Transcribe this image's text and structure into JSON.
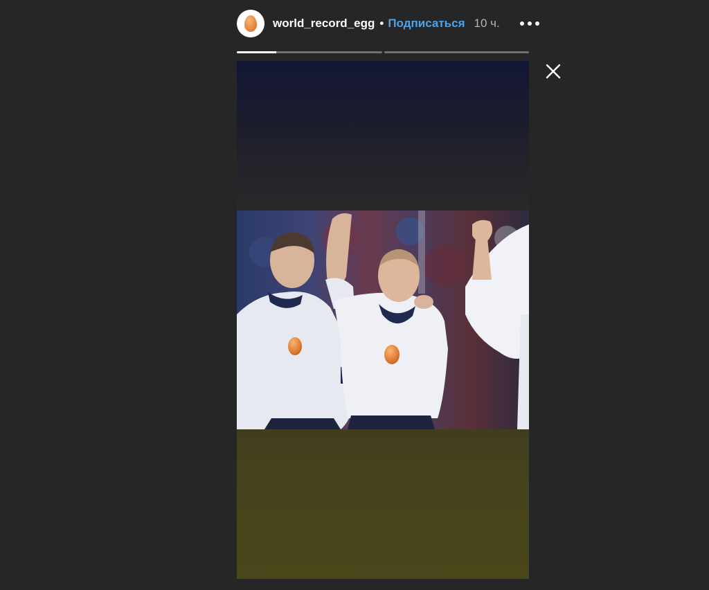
{
  "story": {
    "username": "world_record_egg",
    "separator": "•",
    "follow_label": "Подписаться",
    "time_ago": "10 ч.",
    "segments": [
      {
        "progress": 0.27
      },
      {
        "progress": 0
      }
    ]
  },
  "icons": {
    "avatar": "egg-avatar-icon",
    "more": "more-options-icon",
    "close": "close-icon"
  },
  "colors": {
    "background": "#262626",
    "follow_link": "#4ea3e8",
    "egg": "#e98b3f"
  }
}
